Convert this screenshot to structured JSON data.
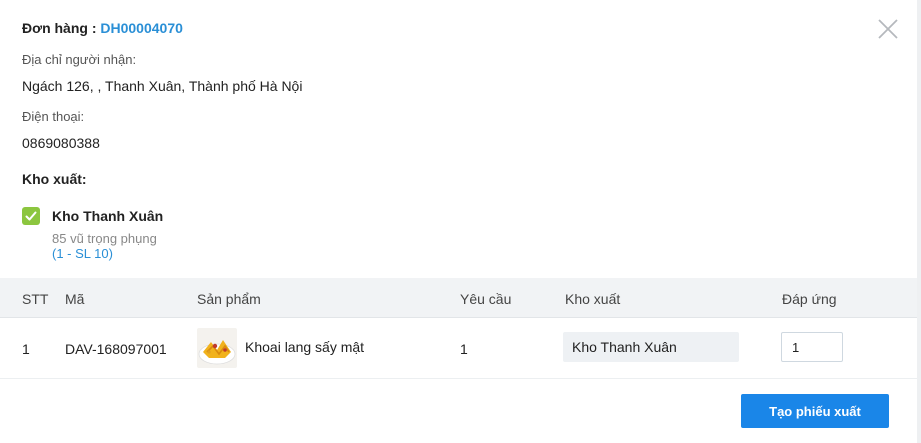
{
  "order": {
    "label": "Đơn hàng : ",
    "code": "DH00004070"
  },
  "recipient": {
    "address_label": "Địa chỉ người nhận:",
    "address": "Ngách 126, , Thanh Xuân, Thành phố Hà Nội",
    "phone_label": "Điện thoại:",
    "phone": "0869080388"
  },
  "warehouse_section": {
    "title": "Kho xuất:",
    "warehouse": {
      "checked": true,
      "name": "Kho Thanh Xuân",
      "address": "85 vũ trọng phụng",
      "quantity": "(1 - SL 10)"
    }
  },
  "table": {
    "headers": {
      "stt": "STT",
      "code": "Mã",
      "product": "Sản phẩm",
      "requested": "Yêu cầu",
      "warehouse": "Kho xuất",
      "fulfilled": "Đáp ứng"
    },
    "rows": [
      {
        "stt": "1",
        "code": "DAV-168097001",
        "product": "Khoai lang sấy mật",
        "requested": "1",
        "warehouse": "Kho Thanh Xuân",
        "fulfilled": "1"
      }
    ]
  },
  "actions": {
    "create": "Tạo phiếu xuất"
  },
  "colors": {
    "accent": "#1a86e8",
    "link": "#2a8fd6",
    "check": "#8cc63f"
  },
  "icons": {
    "close": "close-icon",
    "check": "check-icon",
    "product": "product-thumbnail"
  }
}
